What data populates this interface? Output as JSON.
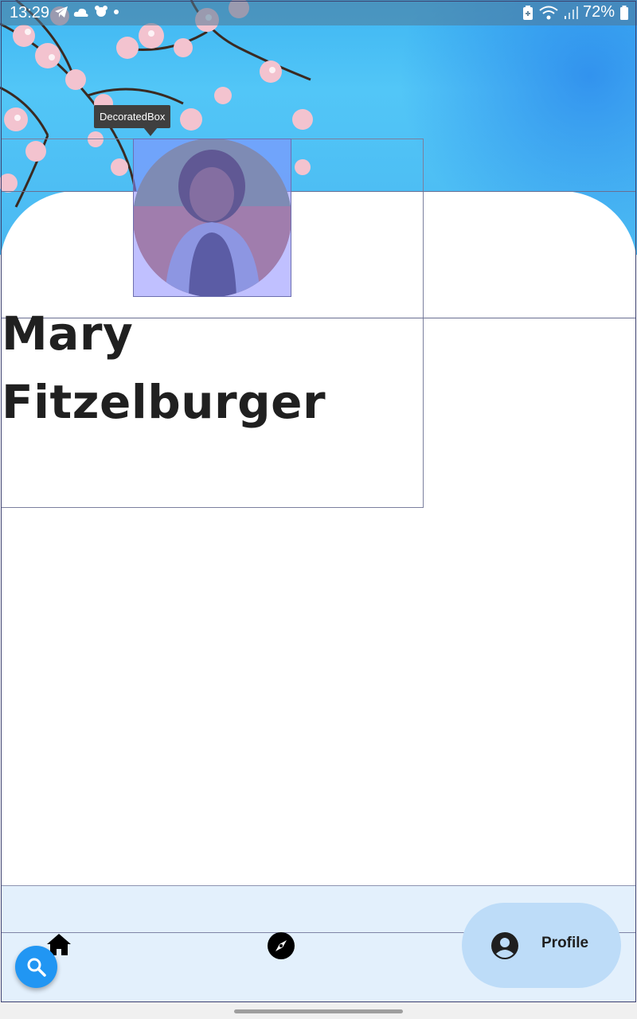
{
  "status_bar": {
    "time": "13:29",
    "battery": "72%",
    "left_icons": [
      "telegram-icon",
      "cloud-icon",
      "notification-icon",
      "dot-icon"
    ],
    "right_icons": [
      "battery-saver-icon",
      "wifi-icon",
      "signal-icon",
      "battery-icon"
    ]
  },
  "inspector": {
    "tooltip": "DecoratedBox"
  },
  "profile": {
    "first_name": "Mary",
    "last_name": "Fitzelburger"
  },
  "bottom_nav": {
    "items": [
      {
        "icon": "home-icon",
        "label": "",
        "active": false
      },
      {
        "icon": "compass-icon",
        "label": "",
        "active": false
      },
      {
        "icon": "account-circle-icon",
        "label": "Profile",
        "active": true
      }
    ],
    "fab_icon": "search-icon"
  },
  "colors": {
    "sky": "#4ab9f2",
    "nav_background": "#e3f0fc",
    "nav_active_pill": "#bddcf8",
    "fab": "#2196f3",
    "inspector_highlight": "#8c8cff"
  }
}
